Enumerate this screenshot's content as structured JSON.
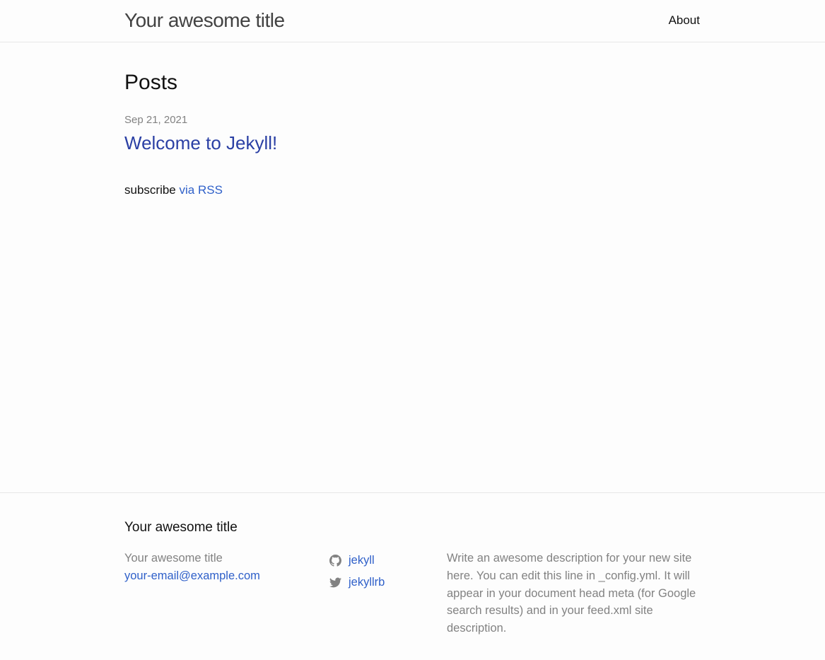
{
  "header": {
    "site_title": "Your awesome title",
    "nav": [
      {
        "label": "About"
      }
    ]
  },
  "main": {
    "heading": "Posts",
    "posts": [
      {
        "date": "Sep 21, 2021",
        "title": "Welcome to Jekyll!"
      }
    ],
    "rss": {
      "prefix": "subscribe",
      "link_label": "via RSS"
    }
  },
  "footer": {
    "heading": "Your awesome title",
    "contact": {
      "name": "Your awesome title",
      "email": "your-email@example.com"
    },
    "social": [
      {
        "icon": "github-icon",
        "label": "jekyll"
      },
      {
        "icon": "twitter-icon",
        "label": "jekyllrb"
      }
    ],
    "description": "Write an awesome description for your new site here. You can edit this line in _config.yml. It will appear in your document head meta (for Google search results) and in your feed.xml site description."
  },
  "colors": {
    "background": "#fdfdfd",
    "text": "#111111",
    "muted": "#828282",
    "link": "#2f60c9",
    "post_link": "#2a3fa4",
    "border": "#e8e8e8"
  }
}
